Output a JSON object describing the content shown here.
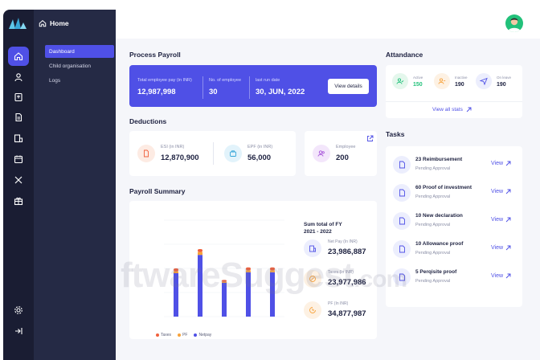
{
  "sidebar": {
    "home_label": "Home",
    "items": [
      {
        "label": "Dashboard",
        "active": true
      },
      {
        "label": "Child organisation",
        "active": false
      },
      {
        "label": "Logs",
        "active": false
      }
    ],
    "rail_icons": [
      "home-icon",
      "user-icon",
      "document-icon",
      "file-icon",
      "finance-icon",
      "calendar-icon",
      "tools-icon",
      "gift-icon",
      "settings-icon",
      "collapse-icon"
    ]
  },
  "process_payroll": {
    "title": "Process Payroll",
    "total_pay_label": "Total employee pay (in INR)",
    "total_pay_value": "12,987,998",
    "employees_label": "No. of employee",
    "employees_value": "30",
    "last_run_label": "last run date",
    "last_run_value": "30, JUN, 2022",
    "view_details": "View details"
  },
  "deductions": {
    "title": "Deductions",
    "esi_label": "ESI (in INR)",
    "esi_value": "12,870,900",
    "epf_label": "EPF (in INR)",
    "epf_value": "56,000",
    "employee_label": "Employee",
    "employee_value": "200"
  },
  "attendance": {
    "title": "Attandance",
    "active_label": "Active",
    "active_value": "150",
    "inactive_label": "Inactive",
    "inactive_value": "190",
    "onleave_label": "On leave",
    "onleave_value": "190",
    "view_all": "View all stats"
  },
  "tasks": {
    "title": "Tasks",
    "view_label": "View",
    "items": [
      {
        "title": "23 Reimbursement",
        "status": "Pending Approval"
      },
      {
        "title": "60 Proof of investment",
        "status": "Pending Approval"
      },
      {
        "title": "10 New declaration",
        "status": "Pending Approval"
      },
      {
        "title": "10 Allowance proof",
        "status": "Pending Approval"
      },
      {
        "title": "5 Perqisite proof",
        "status": "Pending Approval"
      }
    ]
  },
  "payroll_summary": {
    "title": "Payroll Summary",
    "sum_title_line1": "Sum total of FY",
    "sum_title_line2": "2021 - 2022",
    "net_pay_label": "Net Pay (In INR)",
    "net_pay_value": "23,986,887",
    "taxes_label": "Taxes (In INR)",
    "taxes_value": "23,977,986",
    "pf_label": "PF (In INR)",
    "pf_value": "34,877,987"
  },
  "chart_data": {
    "type": "bar",
    "categories": [
      "",
      "",
      "",
      "",
      ""
    ],
    "series": [
      {
        "name": "Taxes",
        "values": [
          0.03,
          0.03,
          0.02,
          0.03,
          0.03
        ]
      },
      {
        "name": "PF",
        "values": [
          0.02,
          0.03,
          0.01,
          0.02,
          0.02
        ]
      },
      {
        "name": "Netpay",
        "values": [
          0.45,
          0.64,
          0.35,
          0.46,
          0.46
        ]
      }
    ],
    "ylim": [
      0,
      1
    ],
    "legend": "bottom",
    "colors": {
      "Taxes": "#f0603c",
      "PF": "#f7a23b",
      "Netpay": "#4f50e6"
    }
  },
  "watermark": {
    "main": "ftwareSuggest",
    "suffix": ".com"
  },
  "colors": {
    "accent": "#4f50e6",
    "sidebar": "#1a1d33",
    "submenu": "#252a45",
    "green": "#22c17a"
  }
}
